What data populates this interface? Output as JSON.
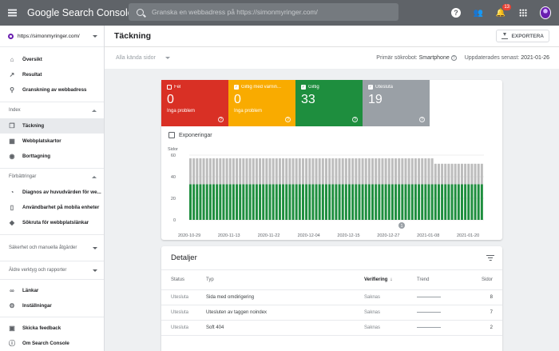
{
  "topbar": {
    "brand": "Google Search Console",
    "search_placeholder": "Granska en webbadress på https://simonmyringer.com/",
    "notification_count": "13"
  },
  "sidebar": {
    "property": "https://simonmyringer.com/",
    "top_items": [
      {
        "label": "Översikt",
        "icon": "home-icon"
      },
      {
        "label": "Resultat",
        "icon": "trending-up-icon"
      },
      {
        "label": "Granskning av webbadress",
        "icon": "search-icon"
      }
    ],
    "index_section": "Index",
    "index_items": [
      {
        "label": "Täckning",
        "icon": "file-copy-icon",
        "active": true
      },
      {
        "label": "Webbplatskartor",
        "icon": "sitemap-icon"
      },
      {
        "label": "Borttagning",
        "icon": "visibility-off-icon"
      }
    ],
    "improvements_section": "Förbättringar",
    "improvements_items": [
      {
        "label": "Diagnos av huvudvärden för we...",
        "icon": "speed-icon"
      },
      {
        "label": "Användbarhet på mobila enheter",
        "icon": "phone-icon"
      },
      {
        "label": "Sökruta för webbplatslänkar",
        "icon": "layers-icon"
      }
    ],
    "security_section": "Säkerhet och manuella åtgärder",
    "legacy_section": "Äldre verktyg och rapporter",
    "bottom_items": [
      {
        "label": "Länkar",
        "icon": "links-icon"
      },
      {
        "label": "Inställningar",
        "icon": "settings-icon"
      }
    ],
    "footer_items": [
      {
        "label": "Skicka feedback",
        "icon": "feedback-icon"
      },
      {
        "label": "Om Search Console",
        "icon": "info-icon"
      }
    ]
  },
  "header": {
    "title": "Täckning",
    "export_label": "EXPORTERA"
  },
  "filter": {
    "selected": "Alla kända sidor",
    "crawler_label": "Primär sökrobot:",
    "crawler_value": "Smartphone",
    "updated_label": "Uppdaterades senast:",
    "updated_value": "2021-01-26"
  },
  "tiles": [
    {
      "label": "Fel",
      "value": "0",
      "sub": "Inga problem",
      "color": "#d93025",
      "checked": false
    },
    {
      "label": "Giltig med varnin...",
      "value": "0",
      "sub": "Inga problem",
      "color": "#f9ab00",
      "checked": true
    },
    {
      "label": "Giltig",
      "value": "33",
      "sub": "",
      "color": "#1e8e3e",
      "checked": true
    },
    {
      "label": "Utesluta",
      "value": "19",
      "sub": "",
      "color": "#9aa0a6",
      "checked": true
    }
  ],
  "impressions_label": "Exponeringar",
  "chart_data": {
    "type": "bar",
    "stacked": true,
    "ylabel": "Sidor",
    "ylim": [
      0,
      60
    ],
    "yticks": [
      0,
      20,
      40,
      60
    ],
    "xtick_labels": [
      "2020-10-29",
      "2020-11-13",
      "2020-11-22",
      "2020-12-04",
      "2020-12-15",
      "2020-12-27",
      "2021-01-08",
      "2021-01-20"
    ],
    "annotation": "1",
    "grid": true,
    "series": [
      {
        "color": "#1e8e3e",
        "values": [
          33,
          33,
          33,
          33,
          33,
          33,
          33,
          33,
          33,
          33,
          33,
          33,
          33,
          33,
          33,
          33,
          33,
          33,
          33,
          33,
          33,
          33,
          33,
          33,
          33,
          33,
          33,
          33,
          33,
          33,
          33,
          33,
          33,
          33,
          33,
          33,
          33,
          33,
          33,
          33,
          33,
          33,
          33,
          33,
          33,
          33,
          33,
          33,
          33,
          33,
          33,
          33,
          33,
          33,
          33,
          33,
          33,
          33,
          33,
          33,
          33,
          33,
          33,
          33,
          33,
          33,
          33,
          33,
          33,
          33,
          33,
          33,
          33,
          33,
          33,
          33,
          33,
          33,
          33,
          33,
          33,
          33,
          33,
          33,
          33,
          33,
          33,
          33,
          33
        ]
      },
      {
        "color": "#bdbdbd",
        "values": [
          24,
          24,
          24,
          24,
          24,
          24,
          24,
          24,
          24,
          24,
          24,
          24,
          24,
          24,
          24,
          24,
          24,
          24,
          24,
          24,
          24,
          24,
          24,
          24,
          24,
          24,
          24,
          24,
          24,
          24,
          24,
          24,
          24,
          24,
          24,
          24,
          24,
          24,
          24,
          24,
          24,
          24,
          24,
          24,
          24,
          24,
          24,
          24,
          24,
          24,
          24,
          24,
          24,
          24,
          24,
          24,
          24,
          24,
          24,
          24,
          24,
          24,
          24,
          24,
          24,
          24,
          24,
          24,
          24,
          24,
          24,
          24,
          24,
          24,
          19,
          19,
          19,
          19,
          19,
          19,
          19,
          19,
          19,
          19,
          19,
          19,
          19,
          19,
          19
        ]
      }
    ]
  },
  "details": {
    "title": "Detaljer",
    "columns": [
      "Status",
      "Typ",
      "Verifiering",
      "Trend",
      "Sidor"
    ],
    "rows": [
      {
        "status": "Utesluta",
        "type": "Sida med omdirigering",
        "verification": "Saknas",
        "pages": "8"
      },
      {
        "status": "Utesluta",
        "type": "Utesluten av taggen noindex",
        "verification": "Saknas",
        "pages": "7"
      },
      {
        "status": "Utesluta",
        "type": "Soft 404",
        "verification": "Saknas",
        "pages": "2"
      }
    ]
  }
}
